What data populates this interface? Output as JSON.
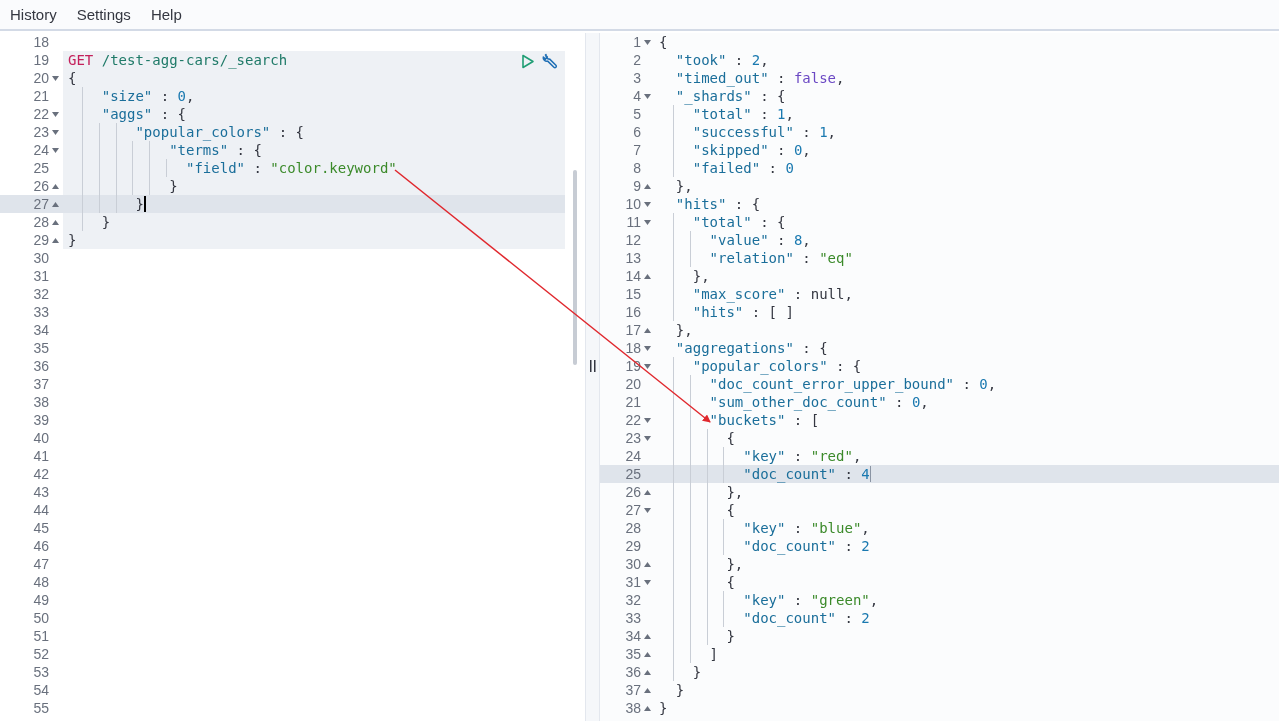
{
  "menu": [
    "History",
    "Settings",
    "Help"
  ],
  "request_panel": {
    "lines": [
      {
        "number": "18",
        "kind": "plain",
        "in_request": false,
        "active": false
      },
      {
        "number": "19",
        "kind": "plain",
        "in_request": true,
        "active": false,
        "actions": true,
        "code": [
          {
            "kind": "method",
            "text": "GET"
          },
          {
            "kind": "path",
            "text": " /test-agg-cars/_search"
          }
        ]
      },
      {
        "number": "20",
        "kind": "fold_start",
        "in_request": true,
        "active": false,
        "code": [
          {
            "kind": "punct",
            "text": "{"
          }
        ]
      },
      {
        "number": "21",
        "kind": "plain",
        "in_request": true,
        "active": false,
        "code": [
          {
            "kind": "key",
            "text": "    \"size\""
          },
          {
            "kind": "punct",
            "text": " : "
          },
          {
            "kind": "number",
            "text": "0"
          },
          {
            "kind": "punct",
            "text": ","
          }
        ]
      },
      {
        "number": "22",
        "kind": "fold_start",
        "in_request": true,
        "active": false,
        "code": [
          {
            "kind": "key",
            "text": "    \"aggs\""
          },
          {
            "kind": "punct",
            "text": " : {"
          }
        ]
      },
      {
        "number": "23",
        "kind": "fold_start",
        "in_request": true,
        "active": false,
        "code": [
          {
            "kind": "key",
            "text": "        \"popular_colors\""
          },
          {
            "kind": "punct",
            "text": " : {"
          }
        ]
      },
      {
        "number": "24",
        "kind": "fold_start",
        "in_request": true,
        "active": false,
        "code": [
          {
            "kind": "key",
            "text": "            \"terms\""
          },
          {
            "kind": "punct",
            "text": " : {"
          }
        ]
      },
      {
        "number": "25",
        "kind": "plain",
        "in_request": true,
        "active": false,
        "code": [
          {
            "kind": "key",
            "text": "              \"field\""
          },
          {
            "kind": "punct",
            "text": " : "
          },
          {
            "kind": "string",
            "text": "\"color.keyword\""
          }
        ]
      },
      {
        "number": "26",
        "kind": "fold_end",
        "in_request": true,
        "active": false,
        "code": [
          {
            "kind": "punct",
            "text": "            }"
          }
        ]
      },
      {
        "number": "27",
        "kind": "fold_end",
        "in_request": true,
        "active": true,
        "code": [
          {
            "kind": "punct",
            "text": "        }"
          }
        ]
      },
      {
        "number": "28",
        "kind": "fold_end",
        "in_request": true,
        "active": false,
        "code": [
          {
            "kind": "punct",
            "text": "    }"
          }
        ]
      },
      {
        "number": "29",
        "kind": "fold_end",
        "in_request": true,
        "active": false,
        "code": [
          {
            "kind": "punct",
            "text": "}"
          }
        ]
      },
      {
        "number": "30",
        "kind": "plain",
        "in_request": false,
        "active": false
      },
      {
        "number": "31",
        "kind": "plain",
        "in_request": false,
        "active": false
      },
      {
        "number": "32",
        "kind": "plain",
        "in_request": false,
        "active": false
      },
      {
        "number": "33",
        "kind": "plain",
        "in_request": false,
        "active": false
      },
      {
        "number": "34",
        "kind": "plain",
        "in_request": false,
        "active": false
      },
      {
        "number": "35",
        "kind": "plain",
        "in_request": false,
        "active": false
      },
      {
        "number": "36",
        "kind": "plain",
        "in_request": false,
        "active": false
      },
      {
        "number": "37",
        "kind": "plain",
        "in_request": false,
        "active": false
      },
      {
        "number": "38",
        "kind": "plain",
        "in_request": false,
        "active": false
      },
      {
        "number": "39",
        "kind": "plain",
        "in_request": false,
        "active": false
      },
      {
        "number": "40",
        "kind": "plain",
        "in_request": false,
        "active": false
      },
      {
        "number": "41",
        "kind": "plain",
        "in_request": false,
        "active": false
      },
      {
        "number": "42",
        "kind": "plain",
        "in_request": false,
        "active": false
      },
      {
        "number": "43",
        "kind": "plain",
        "in_request": false,
        "active": false
      },
      {
        "number": "44",
        "kind": "plain",
        "in_request": false,
        "active": false
      },
      {
        "number": "45",
        "kind": "plain",
        "in_request": false,
        "active": false
      },
      {
        "number": "46",
        "kind": "plain",
        "in_request": false,
        "active": false
      },
      {
        "number": "47",
        "kind": "plain",
        "in_request": false,
        "active": false
      },
      {
        "number": "48",
        "kind": "plain",
        "in_request": false,
        "active": false
      },
      {
        "number": "49",
        "kind": "plain",
        "in_request": false,
        "active": false
      },
      {
        "number": "50",
        "kind": "plain",
        "in_request": false,
        "active": false
      },
      {
        "number": "51",
        "kind": "plain",
        "in_request": false,
        "active": false
      },
      {
        "number": "52",
        "kind": "plain",
        "in_request": false,
        "active": false
      },
      {
        "number": "53",
        "kind": "plain",
        "in_request": false,
        "active": false
      },
      {
        "number": "54",
        "kind": "plain",
        "in_request": false,
        "active": false
      },
      {
        "number": "55",
        "kind": "plain",
        "in_request": false,
        "active": false
      }
    ]
  },
  "response_panel": {
    "lines": [
      {
        "number": "1",
        "kind": "fold_start",
        "active": false,
        "code": [
          {
            "kind": "punct",
            "text": "{"
          }
        ]
      },
      {
        "number": "2",
        "kind": "plain",
        "active": false,
        "code": [
          {
            "kind": "key",
            "text": "  \"took\""
          },
          {
            "kind": "punct",
            "text": " : "
          },
          {
            "kind": "number",
            "text": "2"
          },
          {
            "kind": "punct",
            "text": ","
          }
        ]
      },
      {
        "number": "3",
        "kind": "plain",
        "active": false,
        "code": [
          {
            "kind": "key",
            "text": "  \"timed_out\""
          },
          {
            "kind": "punct",
            "text": " : "
          },
          {
            "kind": "bool",
            "text": "false"
          },
          {
            "kind": "punct",
            "text": ","
          }
        ]
      },
      {
        "number": "4",
        "kind": "fold_start",
        "active": false,
        "code": [
          {
            "kind": "key",
            "text": "  \"_shards\""
          },
          {
            "kind": "punct",
            "text": " : {"
          }
        ]
      },
      {
        "number": "5",
        "kind": "plain",
        "active": false,
        "code": [
          {
            "kind": "key",
            "text": "    \"total\""
          },
          {
            "kind": "punct",
            "text": " : "
          },
          {
            "kind": "number",
            "text": "1"
          },
          {
            "kind": "punct",
            "text": ","
          }
        ]
      },
      {
        "number": "6",
        "kind": "plain",
        "active": false,
        "code": [
          {
            "kind": "key",
            "text": "    \"successful\""
          },
          {
            "kind": "punct",
            "text": " : "
          },
          {
            "kind": "number",
            "text": "1"
          },
          {
            "kind": "punct",
            "text": ","
          }
        ]
      },
      {
        "number": "7",
        "kind": "plain",
        "active": false,
        "code": [
          {
            "kind": "key",
            "text": "    \"skipped\""
          },
          {
            "kind": "punct",
            "text": " : "
          },
          {
            "kind": "number",
            "text": "0"
          },
          {
            "kind": "punct",
            "text": ","
          }
        ]
      },
      {
        "number": "8",
        "kind": "plain",
        "active": false,
        "code": [
          {
            "kind": "key",
            "text": "    \"failed\""
          },
          {
            "kind": "punct",
            "text": " : "
          },
          {
            "kind": "number",
            "text": "0"
          }
        ]
      },
      {
        "number": "9",
        "kind": "fold_end",
        "active": false,
        "code": [
          {
            "kind": "punct",
            "text": "  },"
          }
        ]
      },
      {
        "number": "10",
        "kind": "fold_start",
        "active": false,
        "code": [
          {
            "kind": "key",
            "text": "  \"hits\""
          },
          {
            "kind": "punct",
            "text": " : {"
          }
        ]
      },
      {
        "number": "11",
        "kind": "fold_start",
        "active": false,
        "code": [
          {
            "kind": "key",
            "text": "    \"total\""
          },
          {
            "kind": "punct",
            "text": " : {"
          }
        ]
      },
      {
        "number": "12",
        "kind": "plain",
        "active": false,
        "code": [
          {
            "kind": "key",
            "text": "      \"value\""
          },
          {
            "kind": "punct",
            "text": " : "
          },
          {
            "kind": "number",
            "text": "8"
          },
          {
            "kind": "punct",
            "text": ","
          }
        ]
      },
      {
        "number": "13",
        "kind": "plain",
        "active": false,
        "code": [
          {
            "kind": "key",
            "text": "      \"relation\""
          },
          {
            "kind": "punct",
            "text": " : "
          },
          {
            "kind": "string",
            "text": "\"eq\""
          }
        ]
      },
      {
        "number": "14",
        "kind": "fold_end",
        "active": false,
        "code": [
          {
            "kind": "punct",
            "text": "    },"
          }
        ]
      },
      {
        "number": "15",
        "kind": "plain",
        "active": false,
        "code": [
          {
            "kind": "key",
            "text": "    \"max_score\""
          },
          {
            "kind": "punct",
            "text": " : null,"
          }
        ]
      },
      {
        "number": "16",
        "kind": "plain",
        "active": false,
        "code": [
          {
            "kind": "key",
            "text": "    \"hits\""
          },
          {
            "kind": "punct",
            "text": " : [ ]"
          }
        ]
      },
      {
        "number": "17",
        "kind": "fold_end",
        "active": false,
        "code": [
          {
            "kind": "punct",
            "text": "  },"
          }
        ]
      },
      {
        "number": "18",
        "kind": "fold_start",
        "active": false,
        "code": [
          {
            "kind": "key",
            "text": "  \"aggregations\""
          },
          {
            "kind": "punct",
            "text": " : {"
          }
        ]
      },
      {
        "number": "19",
        "kind": "fold_start",
        "active": false,
        "code": [
          {
            "kind": "key",
            "text": "    \"popular_colors\""
          },
          {
            "kind": "punct",
            "text": " : {"
          }
        ]
      },
      {
        "number": "20",
        "kind": "plain",
        "active": false,
        "code": [
          {
            "kind": "key",
            "text": "      \"doc_count_error_upper_bound\""
          },
          {
            "kind": "punct",
            "text": " : "
          },
          {
            "kind": "number",
            "text": "0"
          },
          {
            "kind": "punct",
            "text": ","
          }
        ]
      },
      {
        "number": "21",
        "kind": "plain",
        "active": false,
        "code": [
          {
            "kind": "key",
            "text": "      \"sum_other_doc_count\""
          },
          {
            "kind": "punct",
            "text": " : "
          },
          {
            "kind": "number",
            "text": "0"
          },
          {
            "kind": "punct",
            "text": ","
          }
        ]
      },
      {
        "number": "22",
        "kind": "fold_start",
        "active": false,
        "code": [
          {
            "kind": "key",
            "text": "      \"buckets\""
          },
          {
            "kind": "punct",
            "text": " : ["
          }
        ]
      },
      {
        "number": "23",
        "kind": "fold_start",
        "active": false,
        "code": [
          {
            "kind": "punct",
            "text": "        {"
          }
        ]
      },
      {
        "number": "24",
        "kind": "plain",
        "active": false,
        "code": [
          {
            "kind": "key",
            "text": "          \"key\""
          },
          {
            "kind": "punct",
            "text": " : "
          },
          {
            "kind": "string",
            "text": "\"red\""
          },
          {
            "kind": "punct",
            "text": ","
          }
        ]
      },
      {
        "number": "25",
        "kind": "plain",
        "active": true,
        "code": [
          {
            "kind": "key",
            "text": "          \"doc_count\""
          },
          {
            "kind": "punct",
            "text": " : "
          },
          {
            "kind": "number",
            "text": "4"
          }
        ]
      },
      {
        "number": "26",
        "kind": "fold_end",
        "active": false,
        "code": [
          {
            "kind": "punct",
            "text": "        },"
          }
        ]
      },
      {
        "number": "27",
        "kind": "fold_start",
        "active": false,
        "code": [
          {
            "kind": "punct",
            "text": "        {"
          }
        ]
      },
      {
        "number": "28",
        "kind": "plain",
        "active": false,
        "code": [
          {
            "kind": "key",
            "text": "          \"key\""
          },
          {
            "kind": "punct",
            "text": " : "
          },
          {
            "kind": "string",
            "text": "\"blue\""
          },
          {
            "kind": "punct",
            "text": ","
          }
        ]
      },
      {
        "number": "29",
        "kind": "plain",
        "active": false,
        "code": [
          {
            "kind": "key",
            "text": "          \"doc_count\""
          },
          {
            "kind": "punct",
            "text": " : "
          },
          {
            "kind": "number",
            "text": "2"
          }
        ]
      },
      {
        "number": "30",
        "kind": "fold_end",
        "active": false,
        "code": [
          {
            "kind": "punct",
            "text": "        },"
          }
        ]
      },
      {
        "number": "31",
        "kind": "fold_start",
        "active": false,
        "code": [
          {
            "kind": "punct",
            "text": "        {"
          }
        ]
      },
      {
        "number": "32",
        "kind": "plain",
        "active": false,
        "code": [
          {
            "kind": "key",
            "text": "          \"key\""
          },
          {
            "kind": "punct",
            "text": " : "
          },
          {
            "kind": "string",
            "text": "\"green\""
          },
          {
            "kind": "punct",
            "text": ","
          }
        ]
      },
      {
        "number": "33",
        "kind": "plain",
        "active": false,
        "code": [
          {
            "kind": "key",
            "text": "          \"doc_count\""
          },
          {
            "kind": "punct",
            "text": " : "
          },
          {
            "kind": "number",
            "text": "2"
          }
        ]
      },
      {
        "number": "34",
        "kind": "fold_end",
        "active": false,
        "code": [
          {
            "kind": "punct",
            "text": "        }"
          }
        ]
      },
      {
        "number": "35",
        "kind": "fold_end",
        "active": false,
        "code": [
          {
            "kind": "punct",
            "text": "      ]"
          }
        ]
      },
      {
        "number": "36",
        "kind": "fold_end",
        "active": false,
        "code": [
          {
            "kind": "punct",
            "text": "    }"
          }
        ]
      },
      {
        "number": "37",
        "kind": "fold_end",
        "active": false,
        "code": [
          {
            "kind": "punct",
            "text": "  }"
          }
        ]
      },
      {
        "number": "38",
        "kind": "fold_end",
        "active": false,
        "code": [
          {
            "kind": "punct",
            "text": "}"
          }
        ]
      }
    ]
  }
}
